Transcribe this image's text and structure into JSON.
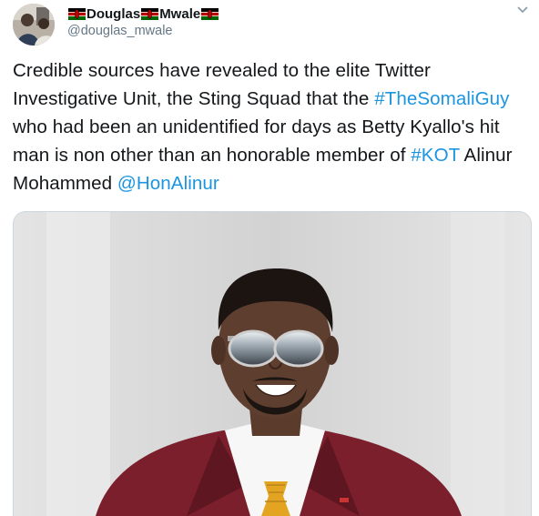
{
  "user": {
    "display_name": "Douglas",
    "display_name_2": "Mwale",
    "handle": "@douglas_mwale",
    "flag_icon": "kenya-flag-icon"
  },
  "tweet": {
    "text_1": "Credible sources have revealed to the elite Twitter Investigative Unit, the Sting Squad that the ",
    "hashtag_1": "#TheSomaliGuy",
    "text_2": " who had been an unidentified for days as Betty Kyallo's hit man is non other than an honorable member of ",
    "hashtag_2": "#KOT",
    "text_3": " Alinur Mohammed ",
    "mention": "@HonAlinur"
  },
  "colors": {
    "link": "#1b95e0",
    "text": "#14171a",
    "secondary": "#657786",
    "blazer": "#7a1f2b",
    "tie": "#e3a521"
  },
  "icons": {
    "menu": "chevron-down-icon"
  }
}
